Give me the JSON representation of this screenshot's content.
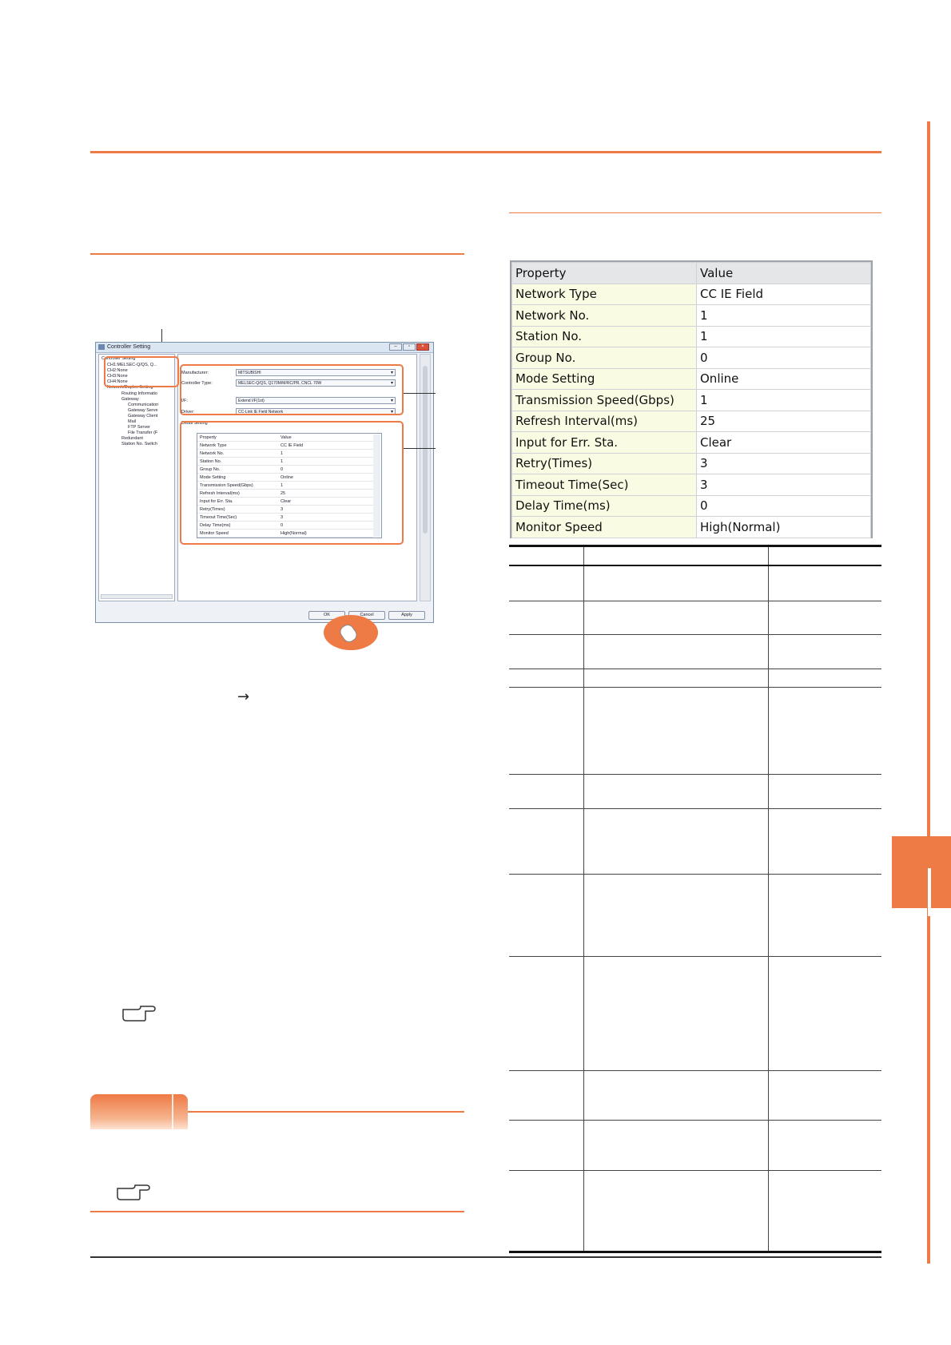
{
  "dialog": {
    "title": "Controller Setting",
    "tree": {
      "root": "Controller Setting",
      "channels": [
        "CH1:MELSEC-Q/QS, Q...",
        "CH2:None",
        "CH3:None",
        "CH4:None"
      ],
      "network_group": "Network/Duplex Setting",
      "items": [
        "Routing Informatio",
        "Gateway",
        "Communication",
        "Gateway Serve",
        "Gateway Client",
        "Mail",
        "FTP Server",
        "File Transfer (F",
        "Redundant",
        "Station No. Switch"
      ]
    },
    "fields": {
      "manufacturer_label": "Manufacturer:",
      "manufacturer_value": "MITSUBISHI",
      "controller_type_label": "Controller Type:",
      "controller_type_value": "MELSEC-Q/QS, Q170M/M/RC/PR, CNCL 70W",
      "if_label": "I/F:",
      "if_value": "Extend I/F(1st)",
      "driver_label": "Driver:",
      "driver_value": "CC-Link IE Field Network"
    },
    "detail_setting_label": "Detail Setting",
    "buttons": {
      "ok": "OK",
      "cancel": "Cancel",
      "apply": "Apply"
    }
  },
  "property_table": {
    "headers": [
      "Property",
      "Value"
    ],
    "rows": [
      [
        "Network Type",
        "CC IE Field"
      ],
      [
        "Network No.",
        "1"
      ],
      [
        "Station No.",
        "1"
      ],
      [
        "Group No.",
        "0"
      ],
      [
        "Mode Setting",
        "Online"
      ],
      [
        "Transmission Speed(Gbps)",
        "1"
      ],
      [
        "Refresh Interval(ms)",
        "25"
      ],
      [
        "Input for Err. Sta.",
        "Clear"
      ],
      [
        "Retry(Times)",
        "3"
      ],
      [
        "Timeout Time(Sec)",
        "3"
      ],
      [
        "Delay Time(ms)",
        "0"
      ],
      [
        "Monitor Speed",
        "High(Normal)"
      ]
    ]
  },
  "arrow_glyph": "→",
  "icons": [
    "reference-hand-icon",
    "mouse-click-icon"
  ],
  "accent_color": "#ee7a45"
}
